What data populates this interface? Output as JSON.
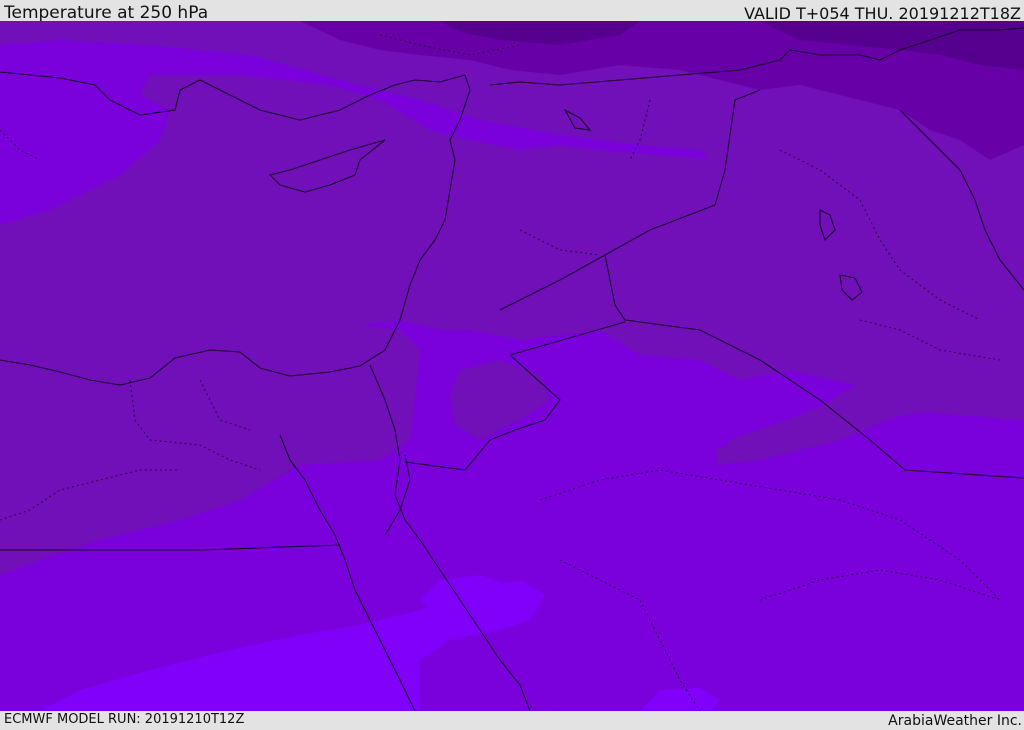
{
  "header": {
    "title": "Temperature at 250 hPa",
    "valid_time": "VALID T+054 THU. 20191212T18Z"
  },
  "footer": {
    "model_run": "ECMWF MODEL RUN: 20191210T12Z",
    "credit": "ArabiaWeather Inc."
  },
  "map": {
    "field": "Temperature at 250 hPa",
    "colors": {
      "coldest": "#56008f",
      "cold": "#6700a6",
      "mid": "#7110b8",
      "warm": "#7a00dc",
      "warmest": "#8000fa",
      "borders": "#1a0030"
    }
  }
}
